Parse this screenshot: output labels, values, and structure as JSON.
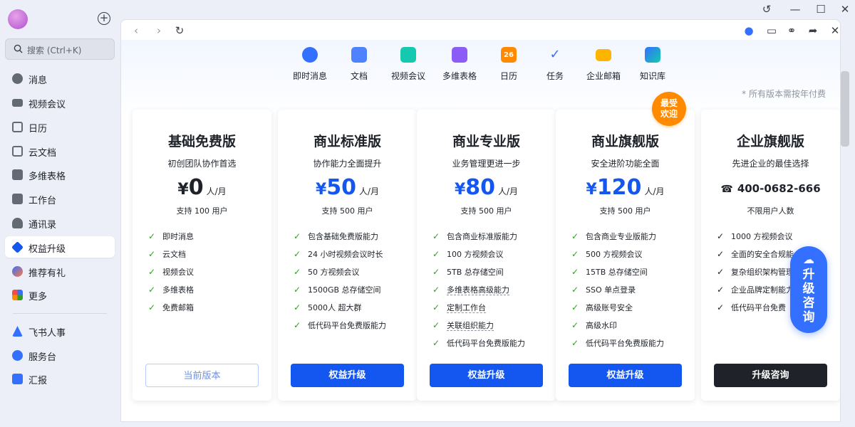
{
  "sidebar": {
    "search_placeholder": "搜索 (Ctrl+K)",
    "items": [
      {
        "label": "消息",
        "icon": "chat-bubble-icon"
      },
      {
        "label": "视频会议",
        "icon": "video-icon"
      },
      {
        "label": "日历",
        "icon": "calendar-icon"
      },
      {
        "label": "云文档",
        "icon": "cloud-doc-icon"
      },
      {
        "label": "多维表格",
        "icon": "table-icon"
      },
      {
        "label": "工作台",
        "icon": "workspace-icon"
      },
      {
        "label": "通讯录",
        "icon": "contacts-icon"
      },
      {
        "label": "权益升级",
        "icon": "diamond-icon",
        "active": true
      },
      {
        "label": "推荐有礼",
        "icon": "gift-person-icon"
      },
      {
        "label": "更多",
        "icon": "more-apps-icon"
      }
    ],
    "apps": [
      {
        "label": "飞书人事",
        "icon": "hr-icon"
      },
      {
        "label": "服务台",
        "icon": "helpdesk-icon"
      },
      {
        "label": "汇报",
        "icon": "report-icon"
      }
    ]
  },
  "features": [
    "即时消息",
    "文档",
    "视频会议",
    "多维表格",
    "日历",
    "任务",
    "企业邮箱",
    "知识库"
  ],
  "calendar_icon_day": "26",
  "note": "* 所有版本需按年付费",
  "badge": [
    "最受",
    "欢迎"
  ],
  "plans": [
    {
      "name": "基础免费版",
      "subtitle": "初创团队协作首选",
      "currency": "¥",
      "price": "0",
      "unit": "人/月",
      "users": "支持 100 用户",
      "features": [
        "即时消息",
        "云文档",
        "视频会议",
        "多维表格",
        "免费邮箱"
      ],
      "button": "当前版本"
    },
    {
      "name": "商业标准版",
      "subtitle": "协作能力全面提升",
      "currency": "¥",
      "price": "50",
      "unit": "人/月",
      "users": "支持 500 用户",
      "features": [
        "包含基础免费版能力",
        "24 小时视频会议时长",
        "50 方视频会议",
        "1500GB 总存储空间",
        "5000人 超大群",
        "低代码平台免费版能力"
      ],
      "button": "权益升级"
    },
    {
      "name": "商业专业版",
      "subtitle": "业务管理更进一步",
      "currency": "¥",
      "price": "80",
      "unit": "人/月",
      "users": "支持 500 用户",
      "features": [
        "包含商业标准版能力",
        "100 方视频会议",
        "5TB 总存储空间",
        "多维表格高级能力",
        "定制工作台",
        "关联组织能力",
        "低代码平台免费版能力"
      ],
      "button": "权益升级"
    },
    {
      "name": "商业旗舰版",
      "subtitle": "安全进阶功能全面",
      "currency": "¥",
      "price": "120",
      "unit": "人/月",
      "users": "支持 500 用户",
      "features": [
        "包含商业专业版能力",
        "500 方视频会议",
        "15TB 总存储空间",
        "SSO 单点登录",
        "高级账号安全",
        "高级水印",
        "低代码平台免费版能力"
      ],
      "button": "权益升级"
    },
    {
      "name": "企业旗舰版",
      "subtitle": "先进企业的最佳选择",
      "phone": "400-0682-666",
      "users": "不限用户人数",
      "features": [
        "1000 方视频会议",
        "全面的安全合规能",
        "复杂组织架构管理",
        "企业品牌定制能力",
        "低代码平台免费"
      ],
      "button": "升级咨询"
    }
  ],
  "consult": {
    "lines": [
      "升",
      "级",
      "咨",
      "询"
    ]
  },
  "colors": {
    "primary": "#1456f0",
    "check": "#2ea121",
    "badge": "#ff8a00"
  }
}
